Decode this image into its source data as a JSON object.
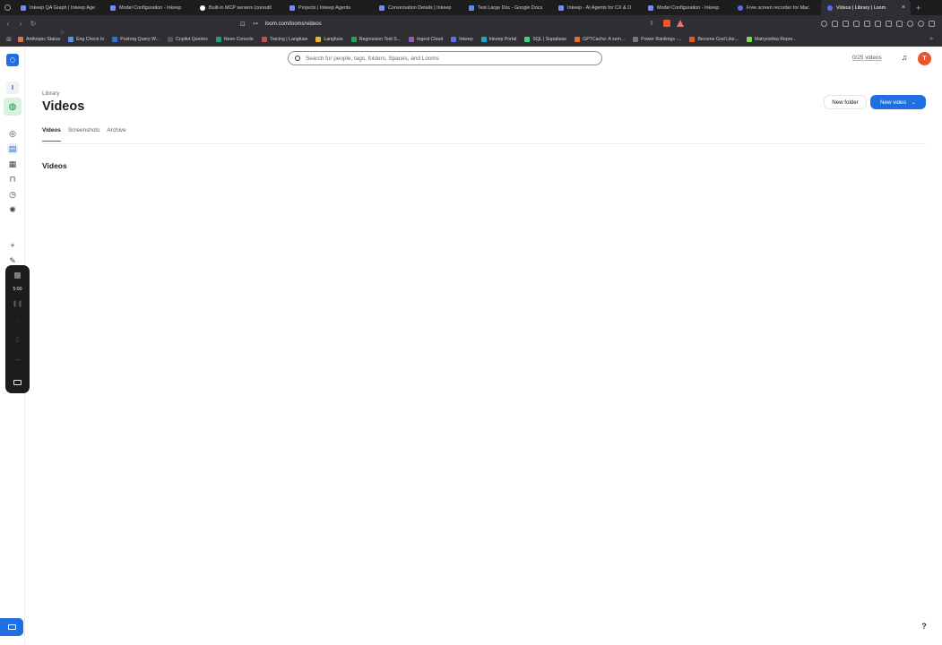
{
  "browser": {
    "tabs": [
      {
        "title": "Inkeep QA Graph | Inkeep Age",
        "favicon": "inkeep"
      },
      {
        "title": "Model Configuration - Inkeep",
        "favicon": "inkeep"
      },
      {
        "title": "Built-in MCP servers (coreutil",
        "favicon": "github"
      },
      {
        "title": "Projects | Inkeep Agents",
        "favicon": "inkeep"
      },
      {
        "title": "Conversation Details | Inkeep",
        "favicon": "inkeep"
      },
      {
        "title": "Test Large Doc - Google Docs",
        "favicon": "doc"
      },
      {
        "title": "Inkeep - AI Agents for CX & O",
        "favicon": "inkeep"
      },
      {
        "title": "Model Configuration - Inkeep",
        "favicon": "inkeep"
      },
      {
        "title": "Free screen recorder for Mac",
        "favicon": "loom"
      },
      {
        "title": "Videos | Library | Loom",
        "favicon": "loom",
        "active": true
      }
    ],
    "new_tab": "+",
    "close": "×",
    "url": "loom.com/looms/videos",
    "bookmarks": [
      "Anthropic Status",
      "Eng Check In",
      "Postrog Query W...",
      "Copilot Queries",
      "Neon Console",
      "Tracing | Langfuse",
      "Langfuse",
      "Regression Test S...",
      "Ingest Cloud",
      "Inkeep",
      "Inkeep Portal",
      "SQL | Supabase",
      "GPTCache: A sem...",
      "Power Rankings -...",
      "Become God Like...",
      "Matryoshka Repre..."
    ],
    "bookmark_more": "»"
  },
  "header": {
    "search_placeholder": "Search for people, tags, folders, Spaces, and Looms",
    "quota": "0/25 videos",
    "avatar_initial": "T"
  },
  "sidebar": {
    "workspace_initial": "I"
  },
  "recorder": {
    "time": "5:00"
  },
  "page": {
    "breadcrumb": "Library",
    "title": "Videos",
    "new_folder": "New folder",
    "new_video": "New video",
    "tabs": [
      {
        "label": "Videos",
        "active": true
      },
      {
        "label": "Screenshots"
      },
      {
        "label": "Archive"
      }
    ],
    "section_title": "Videos"
  },
  "colors": {
    "accent": "#1f6fe0",
    "avatar": "#e8542b"
  }
}
